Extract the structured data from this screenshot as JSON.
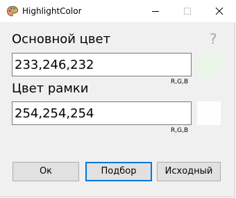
{
  "window": {
    "title": "HighlightColor",
    "icon": "palette-icon",
    "controls": {
      "minimize": "minimize-icon",
      "maximize": "maximize-icon",
      "close": "close-icon"
    }
  },
  "main_color": {
    "label": "Основной цвет",
    "value": "233,246,232",
    "hint": "R,G,B",
    "swatch_color": "#e9f6e8"
  },
  "border_color": {
    "label": "Цвет рамки",
    "value": "254,254,254",
    "hint": "R,G,B",
    "swatch_color": "#fefefe"
  },
  "help": {
    "label": "?"
  },
  "buttons": {
    "ok": "Ок",
    "pick": "Подбор",
    "default": "Исходный"
  }
}
